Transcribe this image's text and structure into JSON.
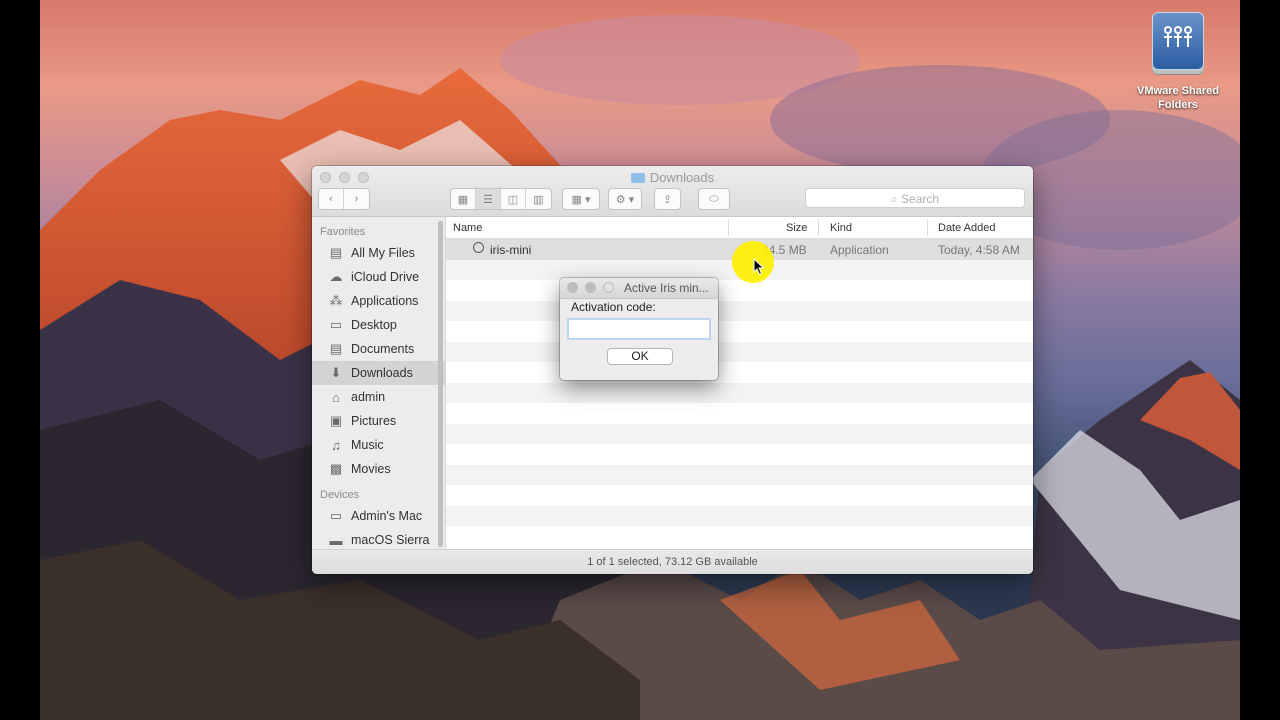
{
  "desktop": {
    "icon_label_line1": "VMware Shared",
    "icon_label_line2": "Folders",
    "icon_name": "vmware-shared-folders-drive-icon"
  },
  "finder": {
    "title": "Downloads",
    "search_placeholder": "Search",
    "sidebar": {
      "favorites_header": "Favorites",
      "favorites": [
        {
          "label": "All My Files",
          "icon": "all-files-icon"
        },
        {
          "label": "iCloud Drive",
          "icon": "cloud-icon"
        },
        {
          "label": "Applications",
          "icon": "applications-icon"
        },
        {
          "label": "Desktop",
          "icon": "desktop-icon"
        },
        {
          "label": "Documents",
          "icon": "documents-icon"
        },
        {
          "label": "Downloads",
          "icon": "downloads-icon",
          "selected": true
        },
        {
          "label": "admin",
          "icon": "home-icon"
        },
        {
          "label": "Pictures",
          "icon": "camera-icon"
        },
        {
          "label": "Music",
          "icon": "music-note-icon"
        },
        {
          "label": "Movies",
          "icon": "film-icon"
        }
      ],
      "devices_header": "Devices",
      "devices": [
        {
          "label": "Admin's Mac",
          "icon": "computer-icon"
        },
        {
          "label": "macOS Sierra",
          "icon": "disk-icon"
        }
      ]
    },
    "columns": {
      "name": "Name",
      "size": "Size",
      "kind": "Kind",
      "date_added": "Date Added"
    },
    "files": [
      {
        "name": "iris-mini",
        "size": "24.5 MB",
        "kind": "Application",
        "date_added": "Today, 4:58 AM"
      }
    ],
    "status": "1 of 1 selected, 73.12 GB available"
  },
  "dialog": {
    "title": "Active Iris min...",
    "label": "Activation code:",
    "input_value": "",
    "ok_label": "OK"
  }
}
